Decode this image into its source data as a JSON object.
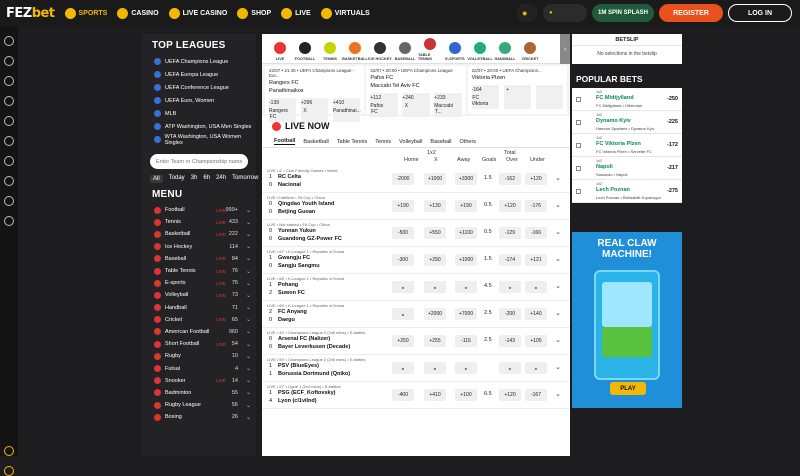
{
  "header": {
    "logo_a": "FEZ",
    "logo_b": "bet",
    "nav": [
      {
        "label": "SPORTS",
        "icon": "soccer-ball-icon",
        "active": true
      },
      {
        "label": "CASINO",
        "icon": "cards-icon"
      },
      {
        "label": "LIVE CASINO",
        "icon": "roulette-icon"
      },
      {
        "label": "SHOP",
        "icon": "shop-icon"
      },
      {
        "label": "LIVE",
        "icon": "live-icon"
      },
      {
        "label": "VIRTUALS",
        "icon": "virtuals-icon"
      }
    ],
    "promo_spin": "1M SPIN SPLASH",
    "register": "REGISTER",
    "login": "LOG IN"
  },
  "sidebar": {
    "top_leagues_title": "TOP LEAGUES",
    "leagues": [
      "UEFA Champions League",
      "UEFA Europa League",
      "UEFA Conference League",
      "UEFA Euro, Women",
      "MLB",
      "ATP Washington, USA Men Singles",
      "WTA Washington, USA Women Singles"
    ],
    "search_placeholder": "Enter Team or Championship name",
    "filters": [
      "All",
      "Today",
      "3h",
      "6h",
      "24h",
      "Tomorrow"
    ],
    "menu_title": "MENU",
    "sports": [
      {
        "name": "Football",
        "live": "LIVE",
        "count": "999+"
      },
      {
        "name": "Tennis",
        "live": "LIVE",
        "count": "433"
      },
      {
        "name": "Basketball",
        "live": "LIVE",
        "count": "222"
      },
      {
        "name": "Ice Hockey",
        "live": "",
        "count": "114"
      },
      {
        "name": "Baseball",
        "live": "LIVE",
        "count": "84"
      },
      {
        "name": "Table Tennis",
        "live": "LIVE",
        "count": "76"
      },
      {
        "name": "E-sports",
        "live": "LIVE",
        "count": "75"
      },
      {
        "name": "Volleyball",
        "live": "LIVE",
        "count": "73"
      },
      {
        "name": "Handball",
        "live": "",
        "count": "71"
      },
      {
        "name": "Cricket",
        "live": "LIVE",
        "count": "65"
      },
      {
        "name": "American Football",
        "live": "",
        "count": "960"
      },
      {
        "name": "Short Football",
        "live": "LIVE",
        "count": "54"
      },
      {
        "name": "Rugby",
        "live": "",
        "count": "10"
      },
      {
        "name": "Futsal",
        "live": "",
        "count": "4"
      },
      {
        "name": "Snooker",
        "live": "LIVE",
        "count": "14"
      },
      {
        "name": "Badminton",
        "live": "",
        "count": "55"
      },
      {
        "name": "Rugby League",
        "live": "",
        "count": "56"
      },
      {
        "name": "Boxing",
        "live": "",
        "count": "26"
      }
    ]
  },
  "sport_strip": [
    "LIVE",
    "FOOTBALL",
    "TENNIS",
    "BASKETBALL",
    "ICE HOCKEY",
    "BASEBALL",
    "TABLE TENNIS",
    "E-SPORTS",
    "VOLLEYBALL",
    "HANDBALL",
    "CRICKET"
  ],
  "match_cards": [
    {
      "meta": "22/07 • 21:45 • UEFA Champions League - Eur...",
      "team1": "Rangers FC",
      "team2": "Panathinaikos",
      "o1": "-139",
      "o1l": "Rangers FC",
      "ox": "+296",
      "oxl": "X",
      "o2": "+410",
      "o2l": "Panathinai..."
    },
    {
      "meta": "22/07 • 20:00 • UEFA Champions League",
      "team1": "Pafos FC",
      "team2": "Maccabi Tel Aviv FC",
      "o1": "+112",
      "o1l": "Pafos FC",
      "ox": "+240",
      "oxl": "X",
      "o2": "+233",
      "o2l": "Maccabi T..."
    },
    {
      "meta": "22/07 • 20:00 • UEFA Champions...",
      "team1": "Viktoria Plzen",
      "team2": "",
      "o1": "-164",
      "o1l": "FC Viktoria",
      "ox": "+",
      "oxl": "",
      "o2": "",
      "o2l": ""
    }
  ],
  "live": {
    "title": "LIVE NOW",
    "tabs": [
      "Football",
      "Basketball",
      "Table Tennis",
      "Tennis",
      "Volleyball",
      "Baseball",
      "Others"
    ],
    "cols": {
      "g1": "1x2",
      "g2": "Total",
      "home": "Home",
      "x": "X",
      "away": "Away",
      "goals": "Goals",
      "over": "Over",
      "under": "Under"
    },
    "matches": [
      {
        "meta": "LIVE • 6' • Club Friendly Games • World",
        "s1": "1",
        "t1": "RC Celta",
        "s2": "0",
        "t2": "Nacional",
        "home": "-2000",
        "x": "+1000",
        "away": "+3300",
        "goals": "1.5",
        "over": "-162",
        "under": "+120"
      },
      {
        "meta": "LIVE • Halftime • FA Cup • China",
        "s1": "0",
        "t1": "Qingdao Youth Island",
        "s2": "0",
        "t2": "Beijing Guoan",
        "home": "+190",
        "x": "+130",
        "away": "+190",
        "goals": "0.5",
        "over": "+120",
        "under": "-176"
      },
      {
        "meta": "LIVE • Not started • FA Cup • China",
        "s1": "0",
        "t1": "Yunnan Yukun",
        "s2": "0",
        "t2": "Guandong GZ-Power FC",
        "home": "-500",
        "x": "+550",
        "away": "+1100",
        "goals": "0.5",
        "over": "-129",
        "under": "-166"
      },
      {
        "meta": "LIVE • 67' • K-League 1 • Republic of Korea",
        "s1": "1",
        "t1": "Gwangju FC",
        "s2": "0",
        "t2": "Sangju Sangmu",
        "home": "-300",
        "x": "+290",
        "away": "+1000",
        "goals": "1.5",
        "over": "-174",
        "under": "+121"
      },
      {
        "meta": "LIVE • 68' • K-League 1 • Republic of Korea",
        "s1": "1",
        "t1": "Pohang",
        "s2": "2",
        "t2": "Suwon FC",
        "home": "",
        "x": "",
        "away": "",
        "goals": "4.5",
        "over": "",
        "under": ""
      },
      {
        "meta": "LIVE • 69' • K-League 1 • Republic of Korea",
        "s1": "2",
        "t1": "FC Anyang",
        "s2": "0",
        "t2": "Daegu",
        "home": "",
        "x": "+2000",
        "away": "+7000",
        "goals": "2.5",
        "over": "-200",
        "under": "+140"
      },
      {
        "meta": "LIVE • 44' • Champions League 2 (2x6 mins) • E-battles",
        "s1": "0",
        "t1": "Arsenal FC (Nalizer)",
        "s2": "0",
        "t2": "Bayer Leverkusen (Decade)",
        "home": "+250",
        "x": "+255",
        "away": "-115",
        "goals": "2.5",
        "over": "-143",
        "under": "+105"
      },
      {
        "meta": "LIVE • 59' • Champions League 2 (2x6 mins) • E-battles",
        "s1": "1",
        "t1": "PSV (BlueEyes)",
        "s2": "1",
        "t2": "Borussia Dortmund (Qniko)",
        "home": "",
        "x": "",
        "away": "",
        "goals": "",
        "over": "",
        "under": ""
      },
      {
        "meta": "LIVE • 57' • Ligue 1 (2x4 mins) • E-battles",
        "s1": "1",
        "t1": "PSG (ECF_Koftovsky)",
        "s2": "4",
        "t2": "Lyon (cl1vilnd)",
        "home": "-400",
        "x": "+410",
        "away": "+100",
        "goals": "6.5",
        "over": "+120",
        "under": "-167"
      }
    ]
  },
  "betslip": {
    "title": "BETSLIP",
    "message": "No selections in the betslip"
  },
  "popular": {
    "title": "POPULAR BETS",
    "bets": [
      {
        "sub": "1x2",
        "pick": "FC Midtjylland",
        "match": "FC Midtjylland • Hibernian",
        "odds": "-250"
      },
      {
        "sub": "1x2",
        "pick": "Dynamo Kyiv",
        "match": "Hamrun Spartans • Dynamo Kyiv",
        "odds": "-225"
      },
      {
        "sub": "1x2",
        "pick": "FC Viktoria Plzen",
        "match": "FC Viktoria Plzen • Servette FC",
        "odds": "-172"
      },
      {
        "sub": "1x2",
        "pick": "Napoli",
        "match": "Sassuolo • Napoli",
        "odds": "-217"
      },
      {
        "sub": "1x2",
        "pick": "Lech Poznan",
        "match": "Lech Poznan • Breidablik Kopavogur",
        "odds": "-275"
      }
    ]
  },
  "banner": {
    "title_line1": "REAL CLAW",
    "title_line2": "MACHINE!",
    "play": "PLAY"
  },
  "colors": {
    "accent": "#f5b800",
    "register": "#e8501e",
    "live": "#e33333",
    "bg": "#1d1d1f"
  }
}
